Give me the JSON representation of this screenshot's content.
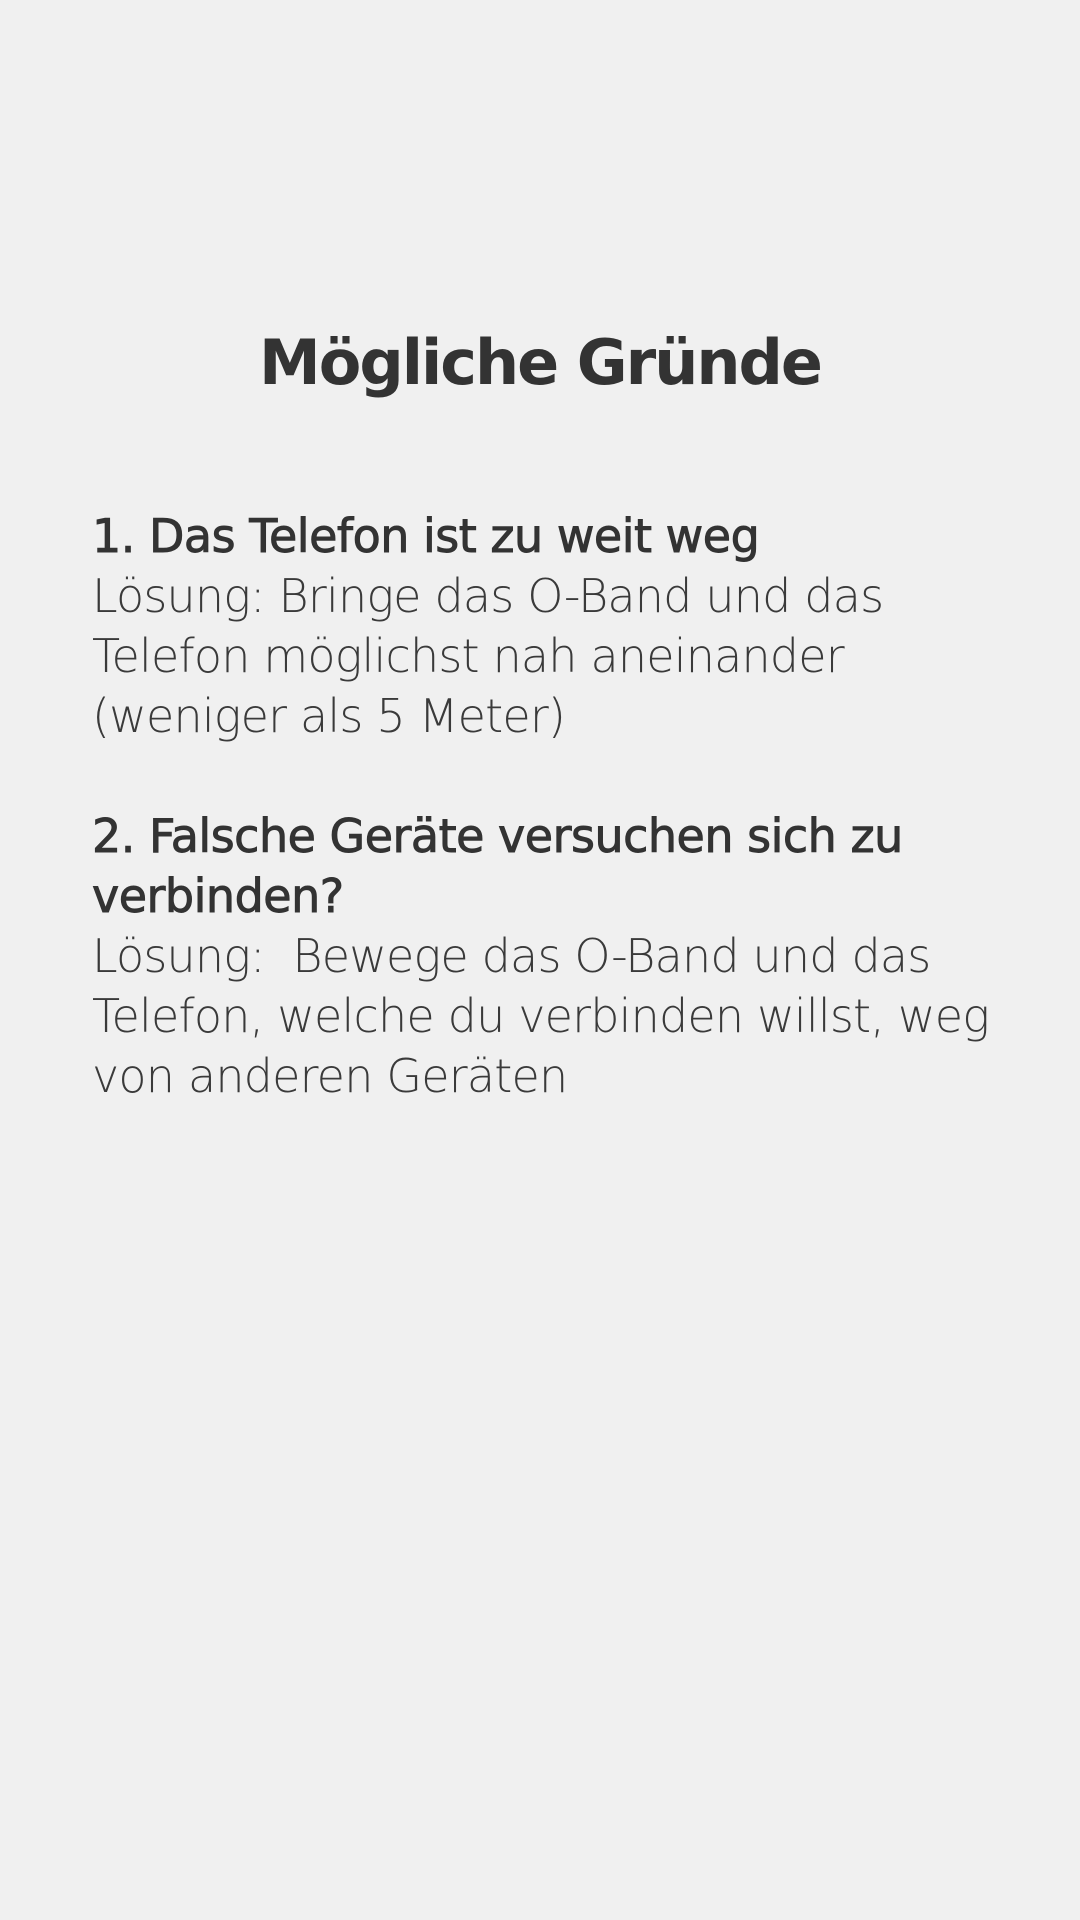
{
  "page": {
    "title": "Mögliche Gründe"
  },
  "reasons": [
    {
      "heading": "1. Das Telefon ist zu weit weg",
      "solution": "Lösung: Bringe das O-Band und das Telefon möglichst nah aneinander (weniger als 5 Meter)"
    },
    {
      "heading": "2. Falsche Geräte versuchen sich zu verbinden?",
      "solution": "Lösung:  Bewege das O-Band und das Telefon, welche du verbinden willst, weg von anderen Geräten"
    }
  ]
}
